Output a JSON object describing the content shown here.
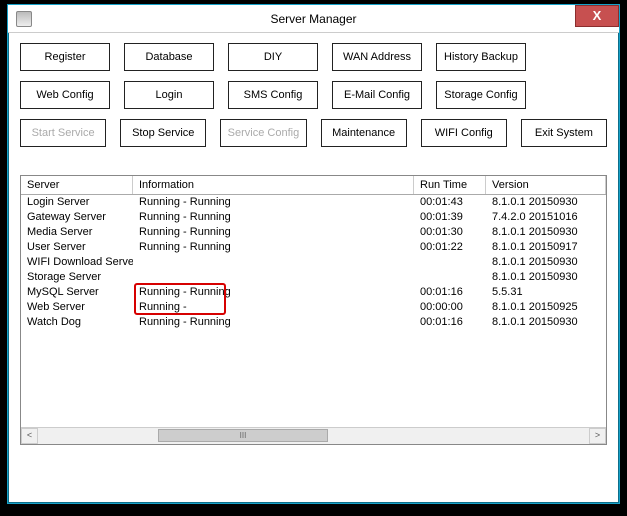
{
  "window": {
    "title": "Server Manager",
    "close_glyph": "X"
  },
  "buttons": {
    "row1": [
      "Register",
      "Database",
      "DIY",
      "WAN Address",
      "History Backup"
    ],
    "row2": [
      "Web Config",
      "Login",
      "SMS Config",
      "E-Mail Config",
      "Storage Config"
    ],
    "row3": [
      "Start Service",
      "Stop Service",
      "Service Config",
      "Maintenance",
      "WIFI Config",
      "Exit System"
    ],
    "disabled": [
      "Start Service",
      "Service Config"
    ]
  },
  "table": {
    "headers": [
      "Server",
      "Information",
      "Run Time",
      "Version"
    ],
    "rows": [
      {
        "server": "Login Server",
        "info": "Running - Running",
        "run": "00:01:43",
        "ver": "8.1.0.1 20150930"
      },
      {
        "server": "Gateway Server",
        "info": "Running - Running",
        "run": "00:01:39",
        "ver": "7.4.2.0 20151016"
      },
      {
        "server": "Media Server",
        "info": "Running - Running",
        "run": "00:01:30",
        "ver": "8.1.0.1 20150930"
      },
      {
        "server": "User Server",
        "info": "Running - Running",
        "run": "00:01:22",
        "ver": "8.1.0.1 20150917"
      },
      {
        "server": "WIFI Download Server",
        "info": "",
        "run": "",
        "ver": "8.1.0.1 20150930"
      },
      {
        "server": "Storage Server",
        "info": "",
        "run": "",
        "ver": "8.1.0.1 20150930"
      },
      {
        "server": "MySQL Server",
        "info": "Running - Running",
        "run": "00:01:16",
        "ver": "5.5.31"
      },
      {
        "server": "Web Server",
        "info": "Running -",
        "run": "00:00:00",
        "ver": "8.1.0.1 20150925"
      },
      {
        "server": "Watch Dog",
        "info": "Running - Running",
        "run": "00:01:16",
        "ver": "8.1.0.1 20150930"
      }
    ]
  },
  "scrollbar": {
    "left_glyph": "<",
    "thumb_glyph": "III",
    "right_glyph": ">"
  }
}
